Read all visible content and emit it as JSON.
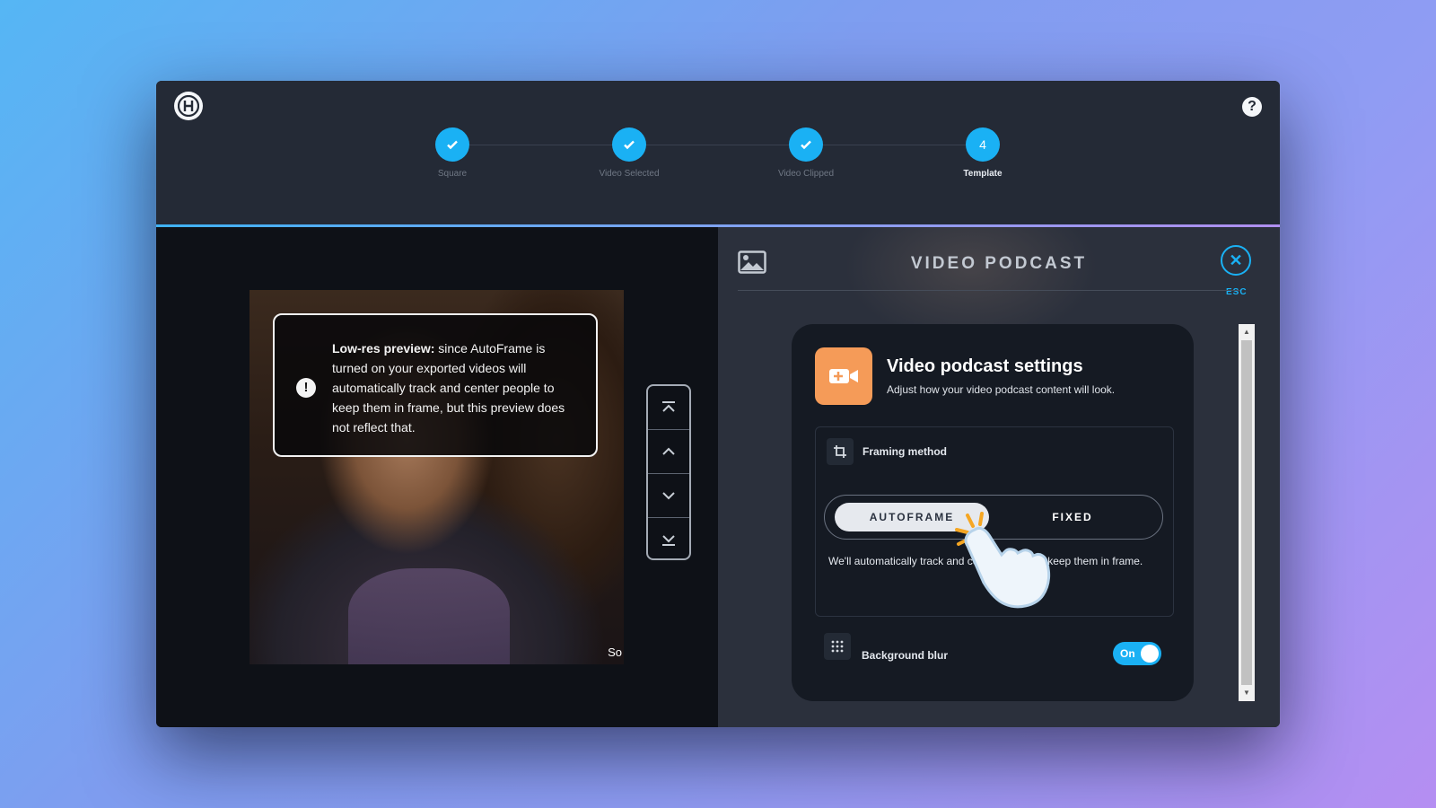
{
  "steps": [
    {
      "label": "Square",
      "state": "done"
    },
    {
      "label": "Video Selected",
      "state": "done"
    },
    {
      "label": "Video Clipped",
      "state": "done"
    },
    {
      "label": "Template",
      "state": "active",
      "number": "4"
    }
  ],
  "help": {
    "label": "?"
  },
  "preview": {
    "notice_bold": "Low-res preview:",
    "notice_text": " since AutoFrame is turned on your exported videos will automatically track and center people to keep them in frame, but this preview does not reflect that.",
    "caption_snippet": "So"
  },
  "panel": {
    "title": "VIDEO PODCAST",
    "esc_label": "ESC",
    "close_symbol": "✕"
  },
  "settings": {
    "title": "Video podcast settings",
    "subtitle": "Adjust how your video podcast content will look.",
    "framing": {
      "label": "Framing method",
      "options": [
        "AUTOFRAME",
        "FIXED"
      ],
      "selected": "AUTOFRAME",
      "description": "We'll automatically track and center people to keep them in frame."
    },
    "background_blur": {
      "label": "Background blur",
      "state_label": "On",
      "enabled": true
    }
  },
  "colors": {
    "accent": "#1ab1f4",
    "orange": "#f59b58",
    "panel": "#151a23"
  }
}
